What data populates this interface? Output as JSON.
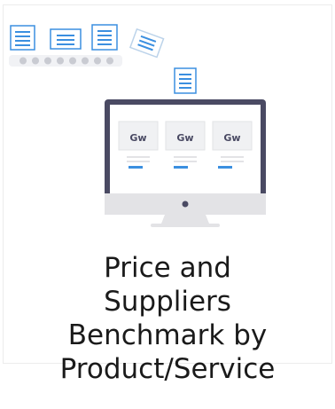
{
  "card": {
    "title_lines": [
      "Price and",
      "Suppliers",
      "Benchmark by",
      "Product/Service"
    ]
  },
  "illustration": {
    "logo_text": "Gw",
    "icons": [
      "document-icon",
      "document-icon",
      "document-icon",
      "document-icon",
      "document-icon"
    ],
    "colors": {
      "accent_blue": "#3b8fe0",
      "monitor_frame": "#4a4a63",
      "monitor_stand": "#e3e3e6",
      "screen_bg": "#ffffff"
    }
  }
}
